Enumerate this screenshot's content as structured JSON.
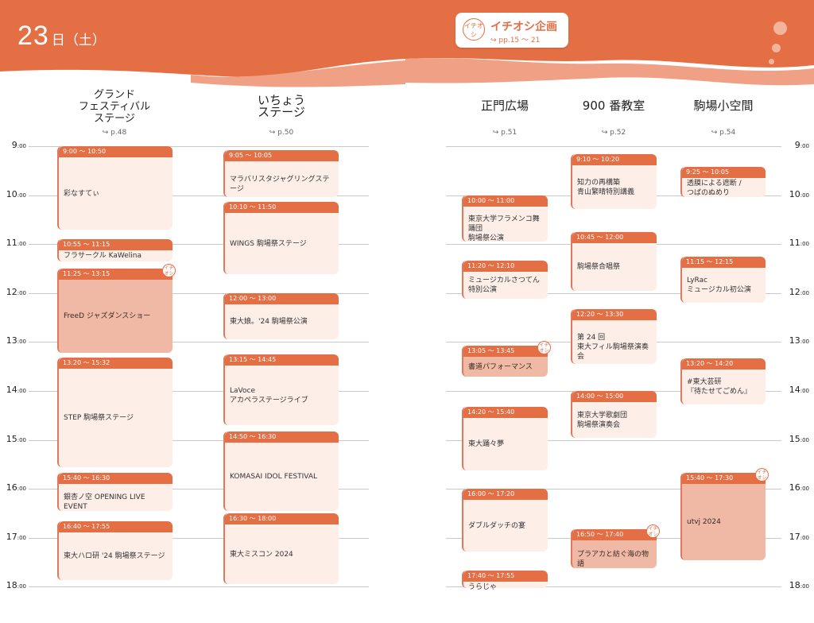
{
  "header": {
    "day_number": "23",
    "day_suffix": "日（土）",
    "badge": {
      "icon_text": "イチオシ",
      "title": "イチオシ企画",
      "pages": "↪ pp.15 ～ 21"
    },
    "colors": {
      "accent": "#e56f45",
      "light": "#fdeee8",
      "pick": "#efb9a6"
    }
  },
  "columns": [
    {
      "id": "grand",
      "name": "グランド\nフェスティバル\nステージ",
      "page": "↪ p.48"
    },
    {
      "id": "icho",
      "name": "いちょう\nステージ",
      "page": "↪ p.50"
    },
    {
      "id": "seimon",
      "name": "正門広場",
      "page": "↪ p.51"
    },
    {
      "id": "room900",
      "name": "900 番教室",
      "page": "↪ p.52"
    },
    {
      "id": "komaba",
      "name": "駒場小空間",
      "page": "↪ p.54"
    }
  ],
  "hours": [
    "9",
    "10",
    "11",
    "12",
    "13",
    "14",
    "15",
    "16",
    "17",
    "18"
  ],
  "hour_suffix": ":00",
  "pick_label": "イチオシ",
  "events": [
    {
      "col": 0,
      "time": "9:00 ～ 10:50",
      "start": 9.0,
      "end": 10.75,
      "title": "彩なすてぃ",
      "pick": false
    },
    {
      "col": 0,
      "time": "10:55 ～ 11:15",
      "start": 10.9,
      "end": 11.4,
      "title": "フラサークル KaWelina",
      "pick": false
    },
    {
      "col": 0,
      "time": "11:25 ～ 13:15",
      "start": 11.5,
      "end": 13.27,
      "title": "FreeD ジャズダンスショー",
      "pick": true
    },
    {
      "col": 0,
      "time": "13:20 ～ 15:32",
      "start": 13.32,
      "end": 15.6,
      "title": "STEP 駒場祭ステージ",
      "pick": false
    },
    {
      "col": 0,
      "time": "15:40 ～ 16:30",
      "start": 15.67,
      "end": 16.5,
      "title": "銀杏ノ空 OPENING LIVE EVENT",
      "pick": false
    },
    {
      "col": 0,
      "time": "16:40 ～ 17:55",
      "start": 16.67,
      "end": 17.92,
      "title": "東大ハロ研 '24 駒場祭ステージ",
      "pick": false
    },
    {
      "col": 1,
      "time": "9:05 ～ 10:05",
      "start": 9.08,
      "end": 10.08,
      "title": "マラバリスタジャグリングステージ",
      "pick": false
    },
    {
      "col": 1,
      "time": "10:10 ～ 11:50",
      "start": 10.13,
      "end": 11.67,
      "title": "WINGS 駒場祭ステージ",
      "pick": false
    },
    {
      "col": 1,
      "time": "12:00 ～ 13:00",
      "start": 12.0,
      "end": 13.0,
      "title": "東大娘。'24 駒場祭公演",
      "pick": false
    },
    {
      "col": 1,
      "time": "13:15 ～ 14:45",
      "start": 13.25,
      "end": 14.75,
      "title": "LaVoce\nアカペラステージライブ",
      "pick": false
    },
    {
      "col": 1,
      "time": "14:50 ～ 16:30",
      "start": 14.83,
      "end": 16.5,
      "title": "KOMASAI IDOL FESTIVAL",
      "pick": false
    },
    {
      "col": 1,
      "time": "16:30 ～ 18:00",
      "start": 16.5,
      "end": 18.0,
      "title": "東大ミスコン 2024",
      "pick": false
    },
    {
      "col": 2,
      "time": "10:00 ～ 11:00",
      "start": 10.0,
      "end": 11.0,
      "title": "東京大学フラメンコ舞踊団\n駒場祭公演",
      "pick": false
    },
    {
      "col": 2,
      "time": "11:20 ～ 12:10",
      "start": 11.33,
      "end": 12.17,
      "title": "ミュージカルさつてん\n特別公演",
      "pick": false
    },
    {
      "col": 2,
      "time": "13:05 ～ 13:45",
      "start": 13.08,
      "end": 13.75,
      "title": "書道パフォーマンス",
      "pick": true
    },
    {
      "col": 2,
      "time": "14:20 ～ 15:40",
      "start": 14.33,
      "end": 15.67,
      "title": "東大踊々夢",
      "pick": false
    },
    {
      "col": 2,
      "time": "16:00 ～ 17:20",
      "start": 16.0,
      "end": 17.33,
      "title": "ダブルダッチの宴",
      "pick": false
    },
    {
      "col": 2,
      "time": "17:40 ～ 17:55",
      "start": 17.67,
      "end": 17.92,
      "title": "うらじゃ",
      "pick": false
    },
    {
      "col": 3,
      "time": "9:10 ～ 10:20",
      "start": 9.17,
      "end": 10.33,
      "title": "知力の再構築\n青山繁晴特別講義",
      "pick": false
    },
    {
      "col": 3,
      "time": "10:45 ～ 12:00",
      "start": 10.75,
      "end": 12.0,
      "title": "駒場祭合唱祭",
      "pick": false
    },
    {
      "col": 3,
      "time": "12:20 ～ 13:30",
      "start": 12.33,
      "end": 13.5,
      "title": "第 24 回\n東大フィル駒場祭演奏会",
      "pick": false
    },
    {
      "col": 3,
      "time": "14:00 ～ 15:00",
      "start": 14.0,
      "end": 15.0,
      "title": "東京大学歌劇団\n駒場祭演奏会",
      "pick": false
    },
    {
      "col": 3,
      "time": "16:50 ～ 17:40",
      "start": 16.83,
      "end": 17.67,
      "title": "プラアカと紡ぐ海の物語",
      "pick": true
    },
    {
      "col": 4,
      "time": "9:25 ～ 10:05",
      "start": 9.42,
      "end": 10.08,
      "title": "透膜による遮断 /\nつばのぬめり",
      "pick": false
    },
    {
      "col": 4,
      "time": "11:15 ～ 12:15",
      "start": 11.25,
      "end": 12.25,
      "title": "LyRac\nミュージカル初公演",
      "pick": false
    },
    {
      "col": 4,
      "time": "13:20 ～ 14:20",
      "start": 13.33,
      "end": 14.33,
      "title": "#東大芸研\n『待たせてごめん』",
      "pick": false
    },
    {
      "col": 4,
      "time": "15:40 ～ 17:30",
      "start": 15.67,
      "end": 17.5,
      "title": "utvj 2024",
      "pick": true
    }
  ]
}
